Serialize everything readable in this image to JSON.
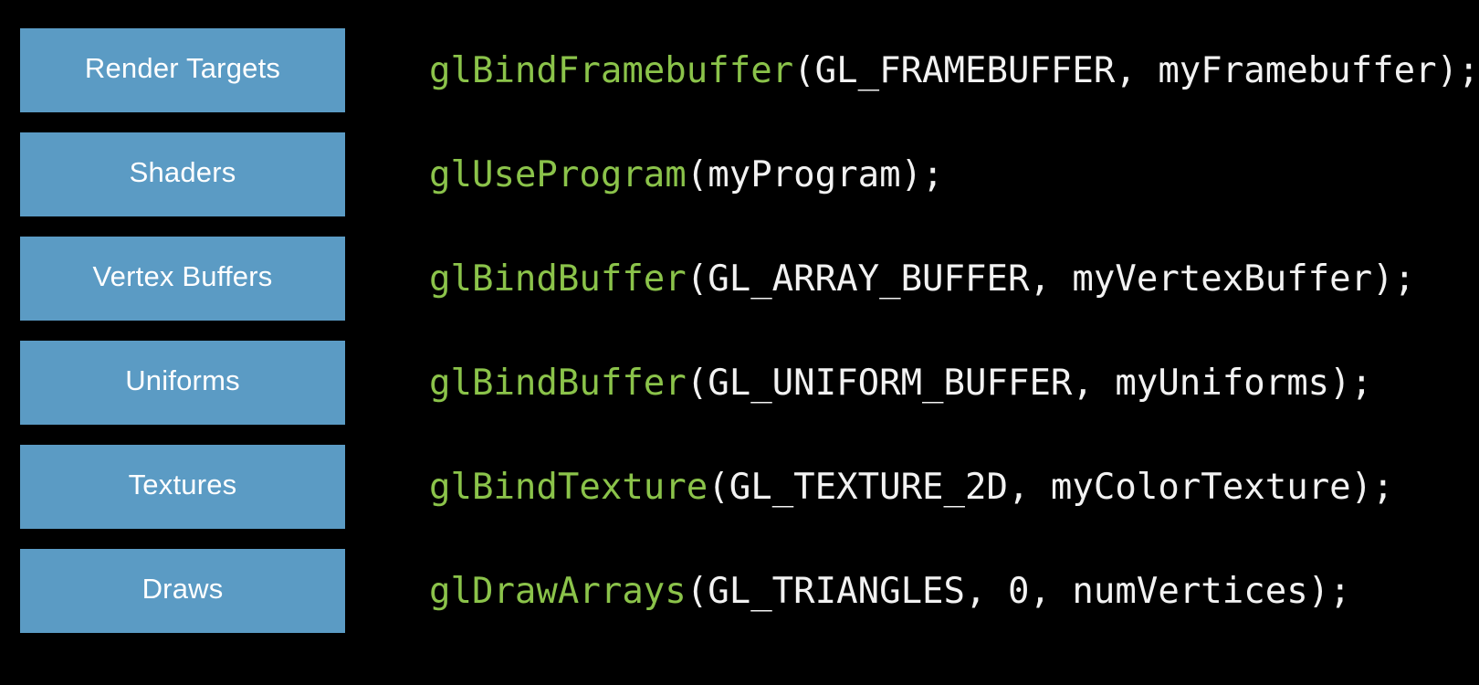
{
  "slide": {
    "background_color": "#000000",
    "box_color": "#5b9bc4",
    "box_label_color": "#ffffff",
    "code_function_color": "#8bc34a",
    "code_text_color": "#f2f2f2"
  },
  "stages": [
    {
      "label": "Render Targets"
    },
    {
      "label": "Shaders"
    },
    {
      "label": "Vertex Buffers"
    },
    {
      "label": "Uniforms"
    },
    {
      "label": "Textures"
    },
    {
      "label": "Draws"
    }
  ],
  "code_lines": [
    {
      "function": "glBindFramebuffer",
      "rest": "(GL_FRAMEBUFFER, myFramebuffer);",
      "full": "glBindFramebuffer(GL_FRAMEBUFFER, myFramebuffer);"
    },
    {
      "function": "glUseProgram",
      "rest": "(myProgram);",
      "full": "glUseProgram(myProgram);"
    },
    {
      "function": "glBindBuffer",
      "rest": "(GL_ARRAY_BUFFER, myVertexBuffer);",
      "full": "glBindBuffer(GL_ARRAY_BUFFER, myVertexBuffer);"
    },
    {
      "function": "glBindBuffer",
      "rest": "(GL_UNIFORM_BUFFER, myUniforms);",
      "full": "glBindBuffer(GL_UNIFORM_BUFFER, myUniforms);"
    },
    {
      "function": "glBindTexture",
      "rest": "(GL_TEXTURE_2D, myColorTexture);",
      "full": "glBindTexture(GL_TEXTURE_2D, myColorTexture);"
    },
    {
      "function": "glDrawArrays",
      "rest": "(GL_TRIANGLES, 0, numVertices);",
      "full": "glDrawArrays(GL_TRIANGLES, 0, numVertices);"
    }
  ]
}
